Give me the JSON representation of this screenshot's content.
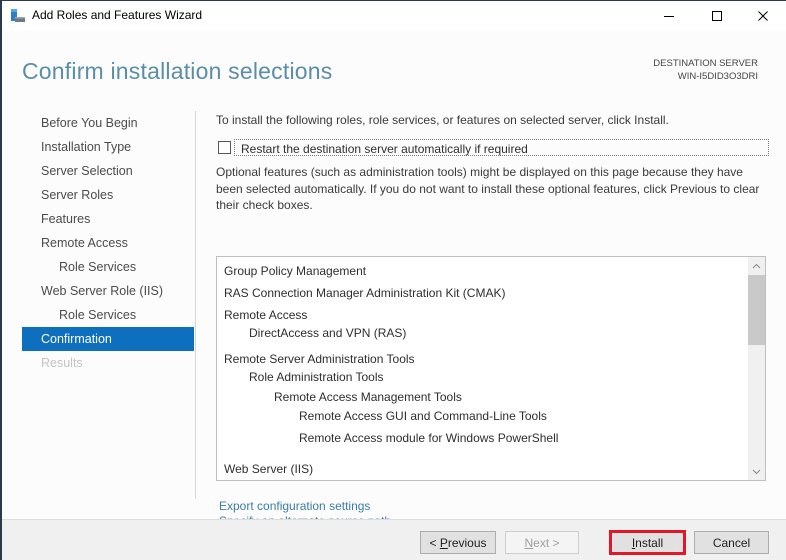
{
  "window": {
    "title": "Add Roles and Features Wizard",
    "controls": {
      "minimize": "—",
      "maximize": "☐",
      "close": "✕"
    }
  },
  "header": {
    "page_title": "Confirm installation selections",
    "destination_label": "DESTINATION SERVER",
    "destination_server": "WIN-I5DID3O3DRI"
  },
  "nav": {
    "items": [
      {
        "label": "Before You Begin",
        "level": 0,
        "state": "normal"
      },
      {
        "label": "Installation Type",
        "level": 0,
        "state": "normal"
      },
      {
        "label": "Server Selection",
        "level": 0,
        "state": "normal"
      },
      {
        "label": "Server Roles",
        "level": 0,
        "state": "normal"
      },
      {
        "label": "Features",
        "level": 0,
        "state": "normal"
      },
      {
        "label": "Remote Access",
        "level": 0,
        "state": "normal"
      },
      {
        "label": "Role Services",
        "level": 1,
        "state": "normal"
      },
      {
        "label": "Web Server Role (IIS)",
        "level": 0,
        "state": "normal"
      },
      {
        "label": "Role Services",
        "level": 1,
        "state": "normal"
      },
      {
        "label": "Confirmation",
        "level": 0,
        "state": "active"
      },
      {
        "label": "Results",
        "level": 0,
        "state": "disabled"
      }
    ]
  },
  "main": {
    "intro": "To install the following roles, role services, or features on selected server, click Install.",
    "restart_checkbox": {
      "label": "Restart the destination server automatically if required",
      "checked": false
    },
    "optional_text": "Optional features (such as administration tools) might be displayed on this page because they have been selected automatically. If you do not want to install these optional features, click Previous to clear their check boxes.",
    "selections": [
      {
        "label": "Group Policy Management",
        "level": 0
      },
      {
        "label": "RAS Connection Manager Administration Kit (CMAK)",
        "level": 0
      },
      {
        "label": "Remote Access",
        "level": 0
      },
      {
        "label": "DirectAccess and VPN (RAS)",
        "level": 1
      },
      {
        "label": "Remote Server Administration Tools",
        "level": 0
      },
      {
        "label": "Role Administration Tools",
        "level": 1
      },
      {
        "label": "Remote Access Management Tools",
        "level": 2
      },
      {
        "label": "Remote Access GUI and Command-Line Tools",
        "level": 3
      },
      {
        "label": "Remote Access module for Windows PowerShell",
        "level": 3
      },
      {
        "label": "Web Server (IIS)",
        "level": 0
      }
    ],
    "links": {
      "export": "Export configuration settings",
      "alternate_source": "Specify an alternate source path"
    }
  },
  "footer": {
    "previous": {
      "prefix": "< ",
      "mnemonic": "P",
      "rest": "revious",
      "enabled": true
    },
    "next": {
      "mnemonic": "N",
      "rest": "ext >",
      "enabled": false
    },
    "install": {
      "mnemonic": "I",
      "rest": "nstall",
      "enabled": true,
      "highlight_color": "#e0182a"
    },
    "cancel": {
      "label": "Cancel",
      "enabled": true
    }
  },
  "colors": {
    "accent": "#0e6fbf",
    "title": "#5a8ea8",
    "link": "#3a7fa8"
  }
}
